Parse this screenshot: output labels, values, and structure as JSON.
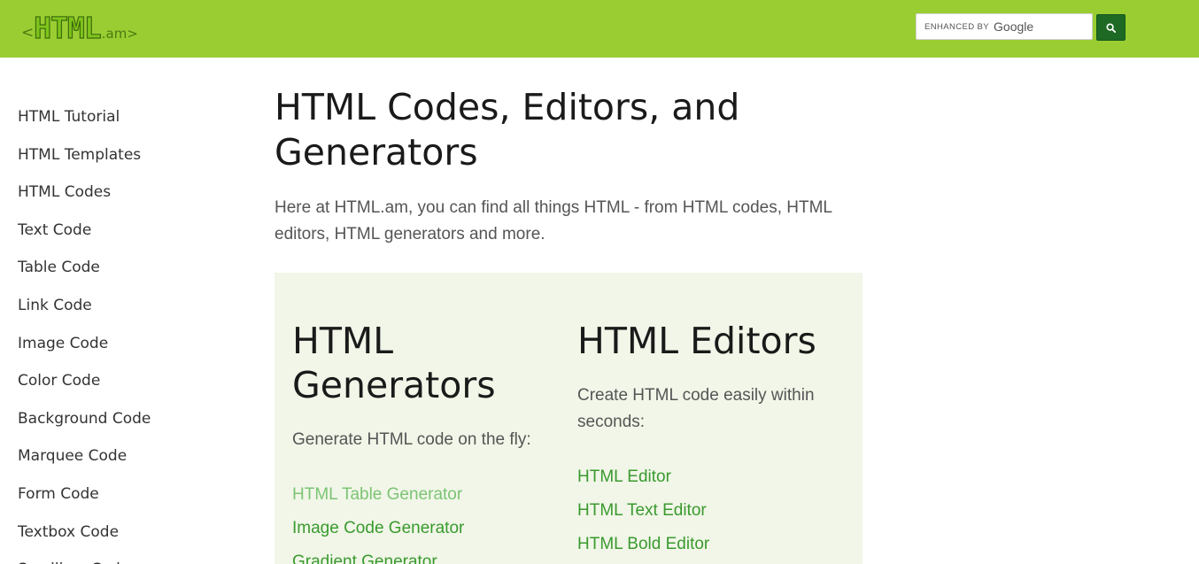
{
  "header": {
    "logo": {
      "bracket_open": "<",
      "main": "HTML",
      "domain": ".am>"
    },
    "search": {
      "placeholder": "",
      "watermark_label": "ENHANCED BY",
      "watermark_brand": "Google",
      "button_icon": "search-icon"
    }
  },
  "sidebar": {
    "items": [
      {
        "label": "HTML Tutorial"
      },
      {
        "label": "HTML Templates"
      },
      {
        "label": "HTML Codes"
      },
      {
        "label": "Text Code"
      },
      {
        "label": "Table Code"
      },
      {
        "label": "Link Code"
      },
      {
        "label": "Image Code"
      },
      {
        "label": "Color Code"
      },
      {
        "label": "Background Code"
      },
      {
        "label": "Marquee Code"
      },
      {
        "label": "Form Code"
      },
      {
        "label": "Textbox Code"
      },
      {
        "label": "Scrollbox Code"
      }
    ]
  },
  "main": {
    "title": "HTML Codes, Editors, and Generators",
    "intro": "Here at HTML.am, you can find all things HTML - from HTML codes, HTML editors, HTML generators and more.",
    "generators": {
      "title": "HTML Generators",
      "description": "Generate HTML code on the fly:",
      "links": [
        {
          "label": "HTML Table Generator"
        },
        {
          "label": "Image Code Generator"
        },
        {
          "label": "Gradient Generator"
        }
      ]
    },
    "editors": {
      "title": "HTML Editors",
      "description": "Create HTML code easily within seconds:",
      "links": [
        {
          "label": "HTML Editor"
        },
        {
          "label": "HTML Text Editor"
        },
        {
          "label": "HTML Bold Editor"
        }
      ]
    }
  },
  "colors": {
    "header_bg": "#9acd32",
    "link": "#3a9a2e",
    "link_visited": "#7cc474",
    "panel_bg": "#f1f6e8",
    "search_button": "#1e6a24"
  }
}
